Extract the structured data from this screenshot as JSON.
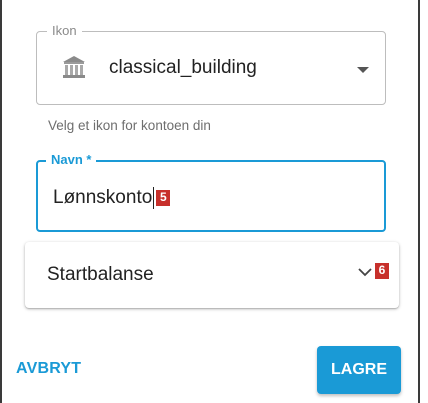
{
  "icon_field": {
    "label": "Ikon",
    "value": "classical_building",
    "icon": "classical-building-icon",
    "helper_text": "Velg et ikon for kontoen din"
  },
  "name_field": {
    "label": "Navn *",
    "value": "Lønnskonto",
    "marker": "5"
  },
  "start_balance": {
    "label": "Startbalanse",
    "marker": "6"
  },
  "actions": {
    "cancel_label": "AVBRYT",
    "save_label": "LAGRE"
  },
  "colors": {
    "accent": "#1a9ad6",
    "marker": "#c7302b"
  }
}
